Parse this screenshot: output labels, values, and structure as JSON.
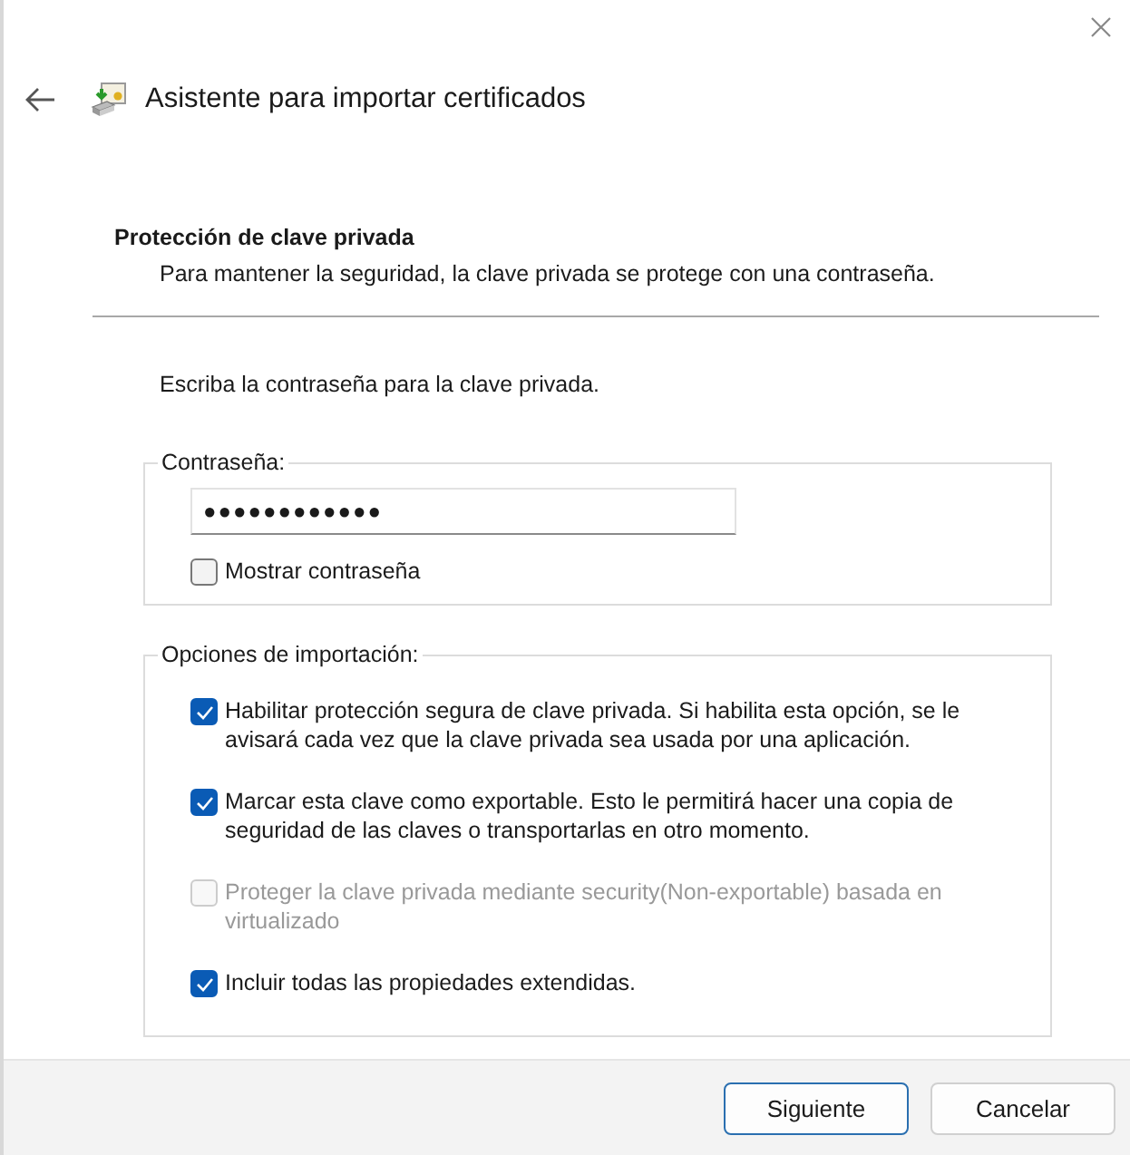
{
  "window": {
    "title": "Asistente para importar certificados"
  },
  "header": {
    "title": "Protección de clave privada",
    "subtitle": "Para mantener la seguridad, la clave privada se protege con una contraseña."
  },
  "prompt": "Escriba la contraseña para la clave privada.",
  "password_group": {
    "legend": "Contraseña:",
    "value": "●●●●●●●●●●●●",
    "show_password": {
      "label": "Mostrar contraseña",
      "checked": false
    }
  },
  "import_options": {
    "legend": "Opciones de importación:",
    "options": [
      {
        "label": "Habilitar protección segura de clave privada. Si habilita esta opción, se le avisará cada vez que la clave privada sea usada por una aplicación.",
        "checked": true,
        "disabled": false
      },
      {
        "label": "Marcar esta clave como exportable. Esto le permitirá hacer una copia de seguridad de las claves o transportarlas en otro momento.",
        "checked": true,
        "disabled": false
      },
      {
        "label": "Proteger la clave privada mediante security(Non-exportable) basada en virtualizado",
        "checked": false,
        "disabled": true
      },
      {
        "label": "Incluir todas las propiedades extendidas.",
        "checked": true,
        "disabled": false
      }
    ]
  },
  "buttons": [
    {
      "label": "Siguiente",
      "default": true
    },
    {
      "label": "Cancelar",
      "default": false
    }
  ]
}
